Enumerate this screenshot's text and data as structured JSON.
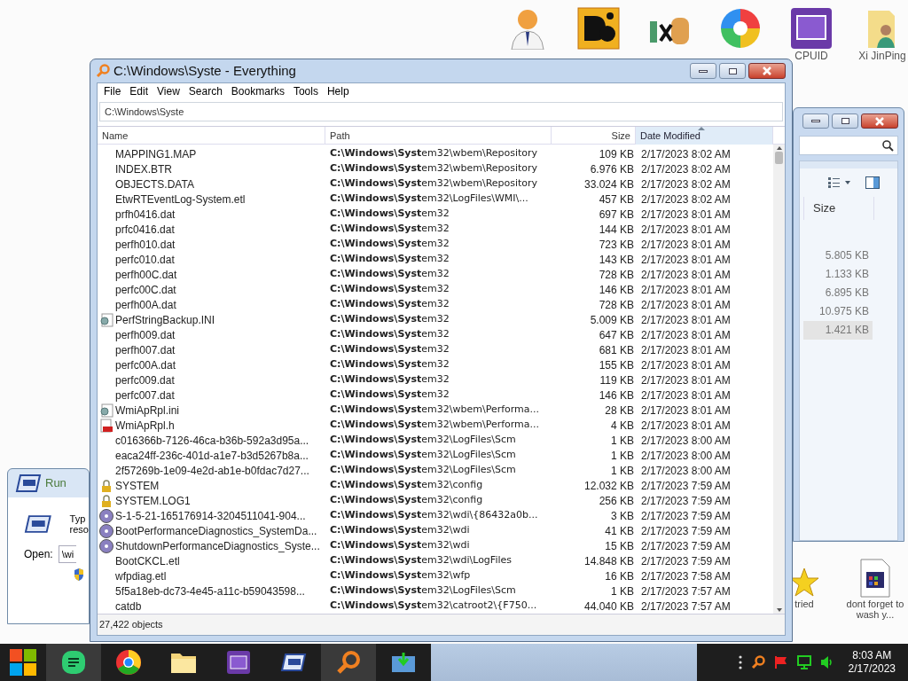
{
  "desktop_icons": [
    {
      "kind": "doctor"
    },
    {
      "kind": "de"
    },
    {
      "kind": "hxd"
    },
    {
      "kind": "ccr"
    },
    {
      "kind": "cpuz",
      "label": "CPUID"
    },
    {
      "kind": "folder",
      "label": "Xi JinPing"
    }
  ],
  "desktop_icons_bottom": [
    {
      "kind": "star",
      "label": "tried"
    },
    {
      "kind": "doc",
      "label": "dont forget to wash y..."
    }
  ],
  "window": {
    "title": "C:\\Windows\\Syste - Everything"
  },
  "menu": [
    "File",
    "Edit",
    "View",
    "Search",
    "Bookmarks",
    "Tools",
    "Help"
  ],
  "search": {
    "value": "C:\\Windows\\Syste"
  },
  "table": {
    "columns": [
      {
        "label": "Name",
        "sorted": false
      },
      {
        "label": "Path",
        "sorted": false
      },
      {
        "label": "Size",
        "sorted": false
      },
      {
        "label": "Date Modified",
        "sorted": true
      }
    ],
    "rows": [
      {
        "kind": "blank",
        "name": "MAPPING1.MAP",
        "path": "**C:\\Windows\\Syst**em32\\wbem\\Repository",
        "size": "109 KB",
        "date": "2/17/2023 8:02 AM"
      },
      {
        "kind": "blank",
        "name": "INDEX.BTR",
        "path": "**C:\\Windows\\Syst**em32\\wbem\\Repository",
        "size": "6.976 KB",
        "date": "2/17/2023 8:02 AM"
      },
      {
        "kind": "blank",
        "name": "OBJECTS.DATA",
        "path": "**C:\\Windows\\Syst**em32\\wbem\\Repository",
        "size": "33.024 KB",
        "date": "2/17/2023 8:02 AM"
      },
      {
        "kind": "blank",
        "name": "EtwRTEventLog-System.etl",
        "path": "**C:\\Windows\\Syst**em32\\LogFiles\\WMI\\...",
        "size": "457 KB",
        "date": "2/17/2023 8:02 AM"
      },
      {
        "kind": "blank",
        "name": "prfh0416.dat",
        "path": "**C:\\Windows\\Syst**em32",
        "size": "697 KB",
        "date": "2/17/2023 8:01 AM"
      },
      {
        "kind": "blank",
        "name": "prfc0416.dat",
        "path": "**C:\\Windows\\Syst**em32",
        "size": "144 KB",
        "date": "2/17/2023 8:01 AM"
      },
      {
        "kind": "blank",
        "name": "perfh010.dat",
        "path": "**C:\\Windows\\Syst**em32",
        "size": "723 KB",
        "date": "2/17/2023 8:01 AM"
      },
      {
        "kind": "blank",
        "name": "perfc010.dat",
        "path": "**C:\\Windows\\Syst**em32",
        "size": "143 KB",
        "date": "2/17/2023 8:01 AM"
      },
      {
        "kind": "blank",
        "name": "perfh00C.dat",
        "path": "**C:\\Windows\\Syst**em32",
        "size": "728 KB",
        "date": "2/17/2023 8:01 AM"
      },
      {
        "kind": "blank",
        "name": "perfc00C.dat",
        "path": "**C:\\Windows\\Syst**em32",
        "size": "146 KB",
        "date": "2/17/2023 8:01 AM"
      },
      {
        "kind": "blank",
        "name": "perfh00A.dat",
        "path": "**C:\\Windows\\Syst**em32",
        "size": "728 KB",
        "date": "2/17/2023 8:01 AM"
      },
      {
        "kind": "ini",
        "name": "PerfStringBackup.INI",
        "path": "**C:\\Windows\\Syst**em32",
        "size": "5.009 KB",
        "date": "2/17/2023 8:01 AM"
      },
      {
        "kind": "blank",
        "name": "perfh009.dat",
        "path": "**C:\\Windows\\Syst**em32",
        "size": "647 KB",
        "date": "2/17/2023 8:01 AM"
      },
      {
        "kind": "blank",
        "name": "perfh007.dat",
        "path": "**C:\\Windows\\Syst**em32",
        "size": "681 KB",
        "date": "2/17/2023 8:01 AM"
      },
      {
        "kind": "blank",
        "name": "perfc00A.dat",
        "path": "**C:\\Windows\\Syst**em32",
        "size": "155 KB",
        "date": "2/17/2023 8:01 AM"
      },
      {
        "kind": "blank",
        "name": "perfc009.dat",
        "path": "**C:\\Windows\\Syst**em32",
        "size": "119 KB",
        "date": "2/17/2023 8:01 AM"
      },
      {
        "kind": "blank",
        "name": "perfc007.dat",
        "path": "**C:\\Windows\\Syst**em32",
        "size": "146 KB",
        "date": "2/17/2023 8:01 AM"
      },
      {
        "kind": "ini",
        "name": "WmiApRpl.ini",
        "path": "**C:\\Windows\\Syst**em32\\wbem\\Performa...",
        "size": "28 KB",
        "date": "2/17/2023 8:01 AM"
      },
      {
        "kind": "h",
        "name": "WmiApRpl.h",
        "path": "**C:\\Windows\\Syst**em32\\wbem\\Performa...",
        "size": "4 KB",
        "date": "2/17/2023 8:01 AM"
      },
      {
        "kind": "blank",
        "name": "c016366b-7126-46ca-b36b-592a3d95a...",
        "path": "**C:\\Windows\\Syst**em32\\LogFiles\\Scm",
        "size": "1 KB",
        "date": "2/17/2023 8:00 AM"
      },
      {
        "kind": "blank",
        "name": "eaca24ff-236c-401d-a1e7-b3d5267b8a...",
        "path": "**C:\\Windows\\Syst**em32\\LogFiles\\Scm",
        "size": "1 KB",
        "date": "2/17/2023 8:00 AM"
      },
      {
        "kind": "blank",
        "name": "2f57269b-1e09-4e2d-ab1e-b0fdac7d27...",
        "path": "**C:\\Windows\\Syst**em32\\LogFiles\\Scm",
        "size": "1 KB",
        "date": "2/17/2023 8:00 AM"
      },
      {
        "kind": "lock",
        "name": "SYSTEM",
        "path": "**C:\\Windows\\Syst**em32\\config",
        "size": "12.032 KB",
        "date": "2/17/2023 7:59 AM"
      },
      {
        "kind": "lock",
        "name": "SYSTEM.LOG1",
        "path": "**C:\\Windows\\Syst**em32\\config",
        "size": "256 KB",
        "date": "2/17/2023 7:59 AM"
      },
      {
        "kind": "disc",
        "name": "S-1-5-21-165176914-3204511041-904...",
        "path": "**C:\\Windows\\Syst**em32\\wdi\\{86432a0b...",
        "size": "3 KB",
        "date": "2/17/2023 7:59 AM"
      },
      {
        "kind": "disc",
        "name": "BootPerformanceDiagnostics_SystemDa...",
        "path": "**C:\\Windows\\Syst**em32\\wdi",
        "size": "41 KB",
        "date": "2/17/2023 7:59 AM"
      },
      {
        "kind": "disc",
        "name": "ShutdownPerformanceDiagnostics_Syste...",
        "path": "**C:\\Windows\\Syst**em32\\wdi",
        "size": "15 KB",
        "date": "2/17/2023 7:59 AM"
      },
      {
        "kind": "blank",
        "name": "BootCKCL.etl",
        "path": "**C:\\Windows\\Syst**em32\\wdi\\LogFiles",
        "size": "14.848 KB",
        "date": "2/17/2023 7:59 AM"
      },
      {
        "kind": "blank",
        "name": "wfpdiag.etl",
        "path": "**C:\\Windows\\Syst**em32\\wfp",
        "size": "16 KB",
        "date": "2/17/2023 7:58 AM"
      },
      {
        "kind": "blank",
        "name": "5f5a18eb-dc73-4e45-a11c-b59043598...",
        "path": "**C:\\Windows\\Syst**em32\\LogFiles\\Scm",
        "size": "1 KB",
        "date": "2/17/2023 7:57 AM"
      },
      {
        "kind": "blank",
        "name": "catdb",
        "path": "**C:\\Windows\\Syst**em32\\catroot2\\{F750...",
        "size": "44.040 KB",
        "date": "2/17/2023 7:57 AM"
      }
    ]
  },
  "status_bar": "27,422 objects",
  "explorer": {
    "column": "Size",
    "sizes": [
      {
        "value": "5.805 KB",
        "selected": false
      },
      {
        "value": "1.133 KB",
        "selected": false
      },
      {
        "value": "6.895 KB",
        "selected": false
      },
      {
        "value": "10.975 KB",
        "selected": false
      },
      {
        "value": "1.421 KB",
        "selected": true
      }
    ]
  },
  "run_dialog": {
    "title": "Run",
    "text": "Typ\nreso",
    "open_label": "Open:",
    "value": "\\wi"
  },
  "taskbar": {
    "apps": [
      {
        "kind": "notes",
        "active": true
      },
      {
        "kind": "chrome",
        "active": false
      },
      {
        "kind": "folder",
        "active": false
      },
      {
        "kind": "cpuz",
        "active": false
      },
      {
        "kind": "run",
        "active": false
      },
      {
        "kind": "search",
        "active": true
      },
      {
        "kind": "install",
        "active": false
      }
    ],
    "time": "8:03 AM",
    "date": "2/17/2023"
  }
}
